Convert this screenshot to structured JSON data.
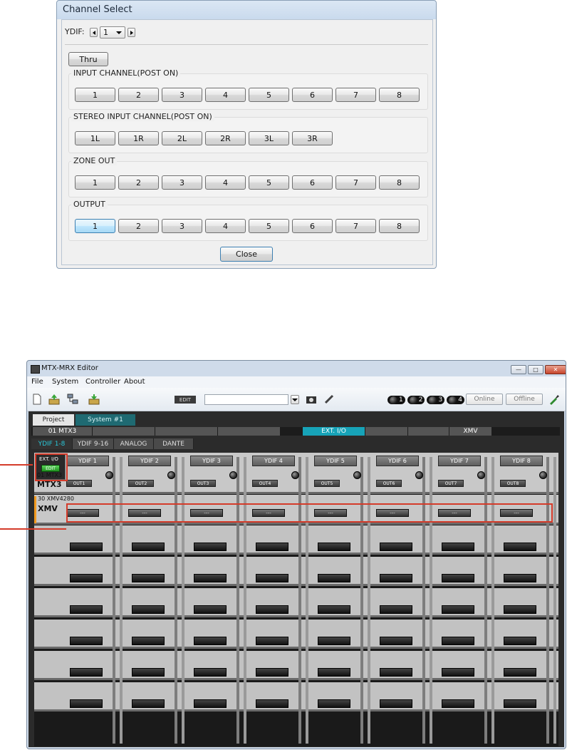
{
  "dialog": {
    "title": "Channel Select",
    "ydif_label": "YDIF:",
    "ydif_value": "1",
    "thru_label": "Thru",
    "close_label": "Close",
    "groups": [
      {
        "title": "INPUT CHANNEL(POST ON)",
        "buttons": [
          "1",
          "2",
          "3",
          "4",
          "5",
          "6",
          "7",
          "8"
        ]
      },
      {
        "title": "STEREO INPUT CHANNEL(POST ON)",
        "buttons": [
          "1L",
          "1R",
          "2L",
          "2R",
          "3L",
          "3R"
        ]
      },
      {
        "title": "ZONE OUT",
        "buttons": [
          "1",
          "2",
          "3",
          "4",
          "5",
          "6",
          "7",
          "8"
        ]
      },
      {
        "title": "OUTPUT",
        "buttons": [
          "1",
          "2",
          "3",
          "4",
          "5",
          "6",
          "7",
          "8"
        ],
        "selected_index": 0
      }
    ]
  },
  "editor": {
    "title": "MTX-MRX Editor",
    "menu": [
      "File",
      "System",
      "Controller",
      "About"
    ],
    "toolbar": {
      "edit_label": "EDIT",
      "online_label": "Online",
      "offline_label": "Offline",
      "leds": [
        "1",
        "2",
        "3",
        "4"
      ]
    },
    "page_tabs": [
      "Project",
      "System #1"
    ],
    "device_bar": {
      "first": "01 MTX3",
      "ext_io": "EXT. I/O",
      "xmv": "XMV"
    },
    "subtabs": [
      "YDIF 1-8",
      "YDIF 9-16",
      "ANALOG",
      "DANTE"
    ],
    "ext_io_label": "EXT. I/O",
    "ext_edit_label": "EDIT",
    "ydif_headers": [
      "YDIF 1",
      "YDIF 2",
      "YDIF 3",
      "YDIF 4",
      "YDIF 5",
      "YDIF 6",
      "YDIF 7",
      "YDIF 8"
    ],
    "mtx_row": {
      "id_label": "01 MTX3",
      "name": "MTX3",
      "outs": [
        "OUT1",
        "OUT2",
        "OUT3",
        "OUT4",
        "OUT5",
        "OUT6",
        "OUT7",
        "OUT8"
      ]
    },
    "xmv_row": {
      "id_label": "30 XMV4280",
      "name": "XMV",
      "slots": [
        "---",
        "---",
        "---",
        "---",
        "---",
        "---",
        "---",
        "---"
      ]
    },
    "empty_rows": 6
  },
  "colors": {
    "callout": "#d43b2a",
    "selected": "#3c7fb1",
    "edit_green": "#2fa82f",
    "ext_io_tab": "#17a3b8",
    "xmv_marker": "#f29a1f"
  }
}
